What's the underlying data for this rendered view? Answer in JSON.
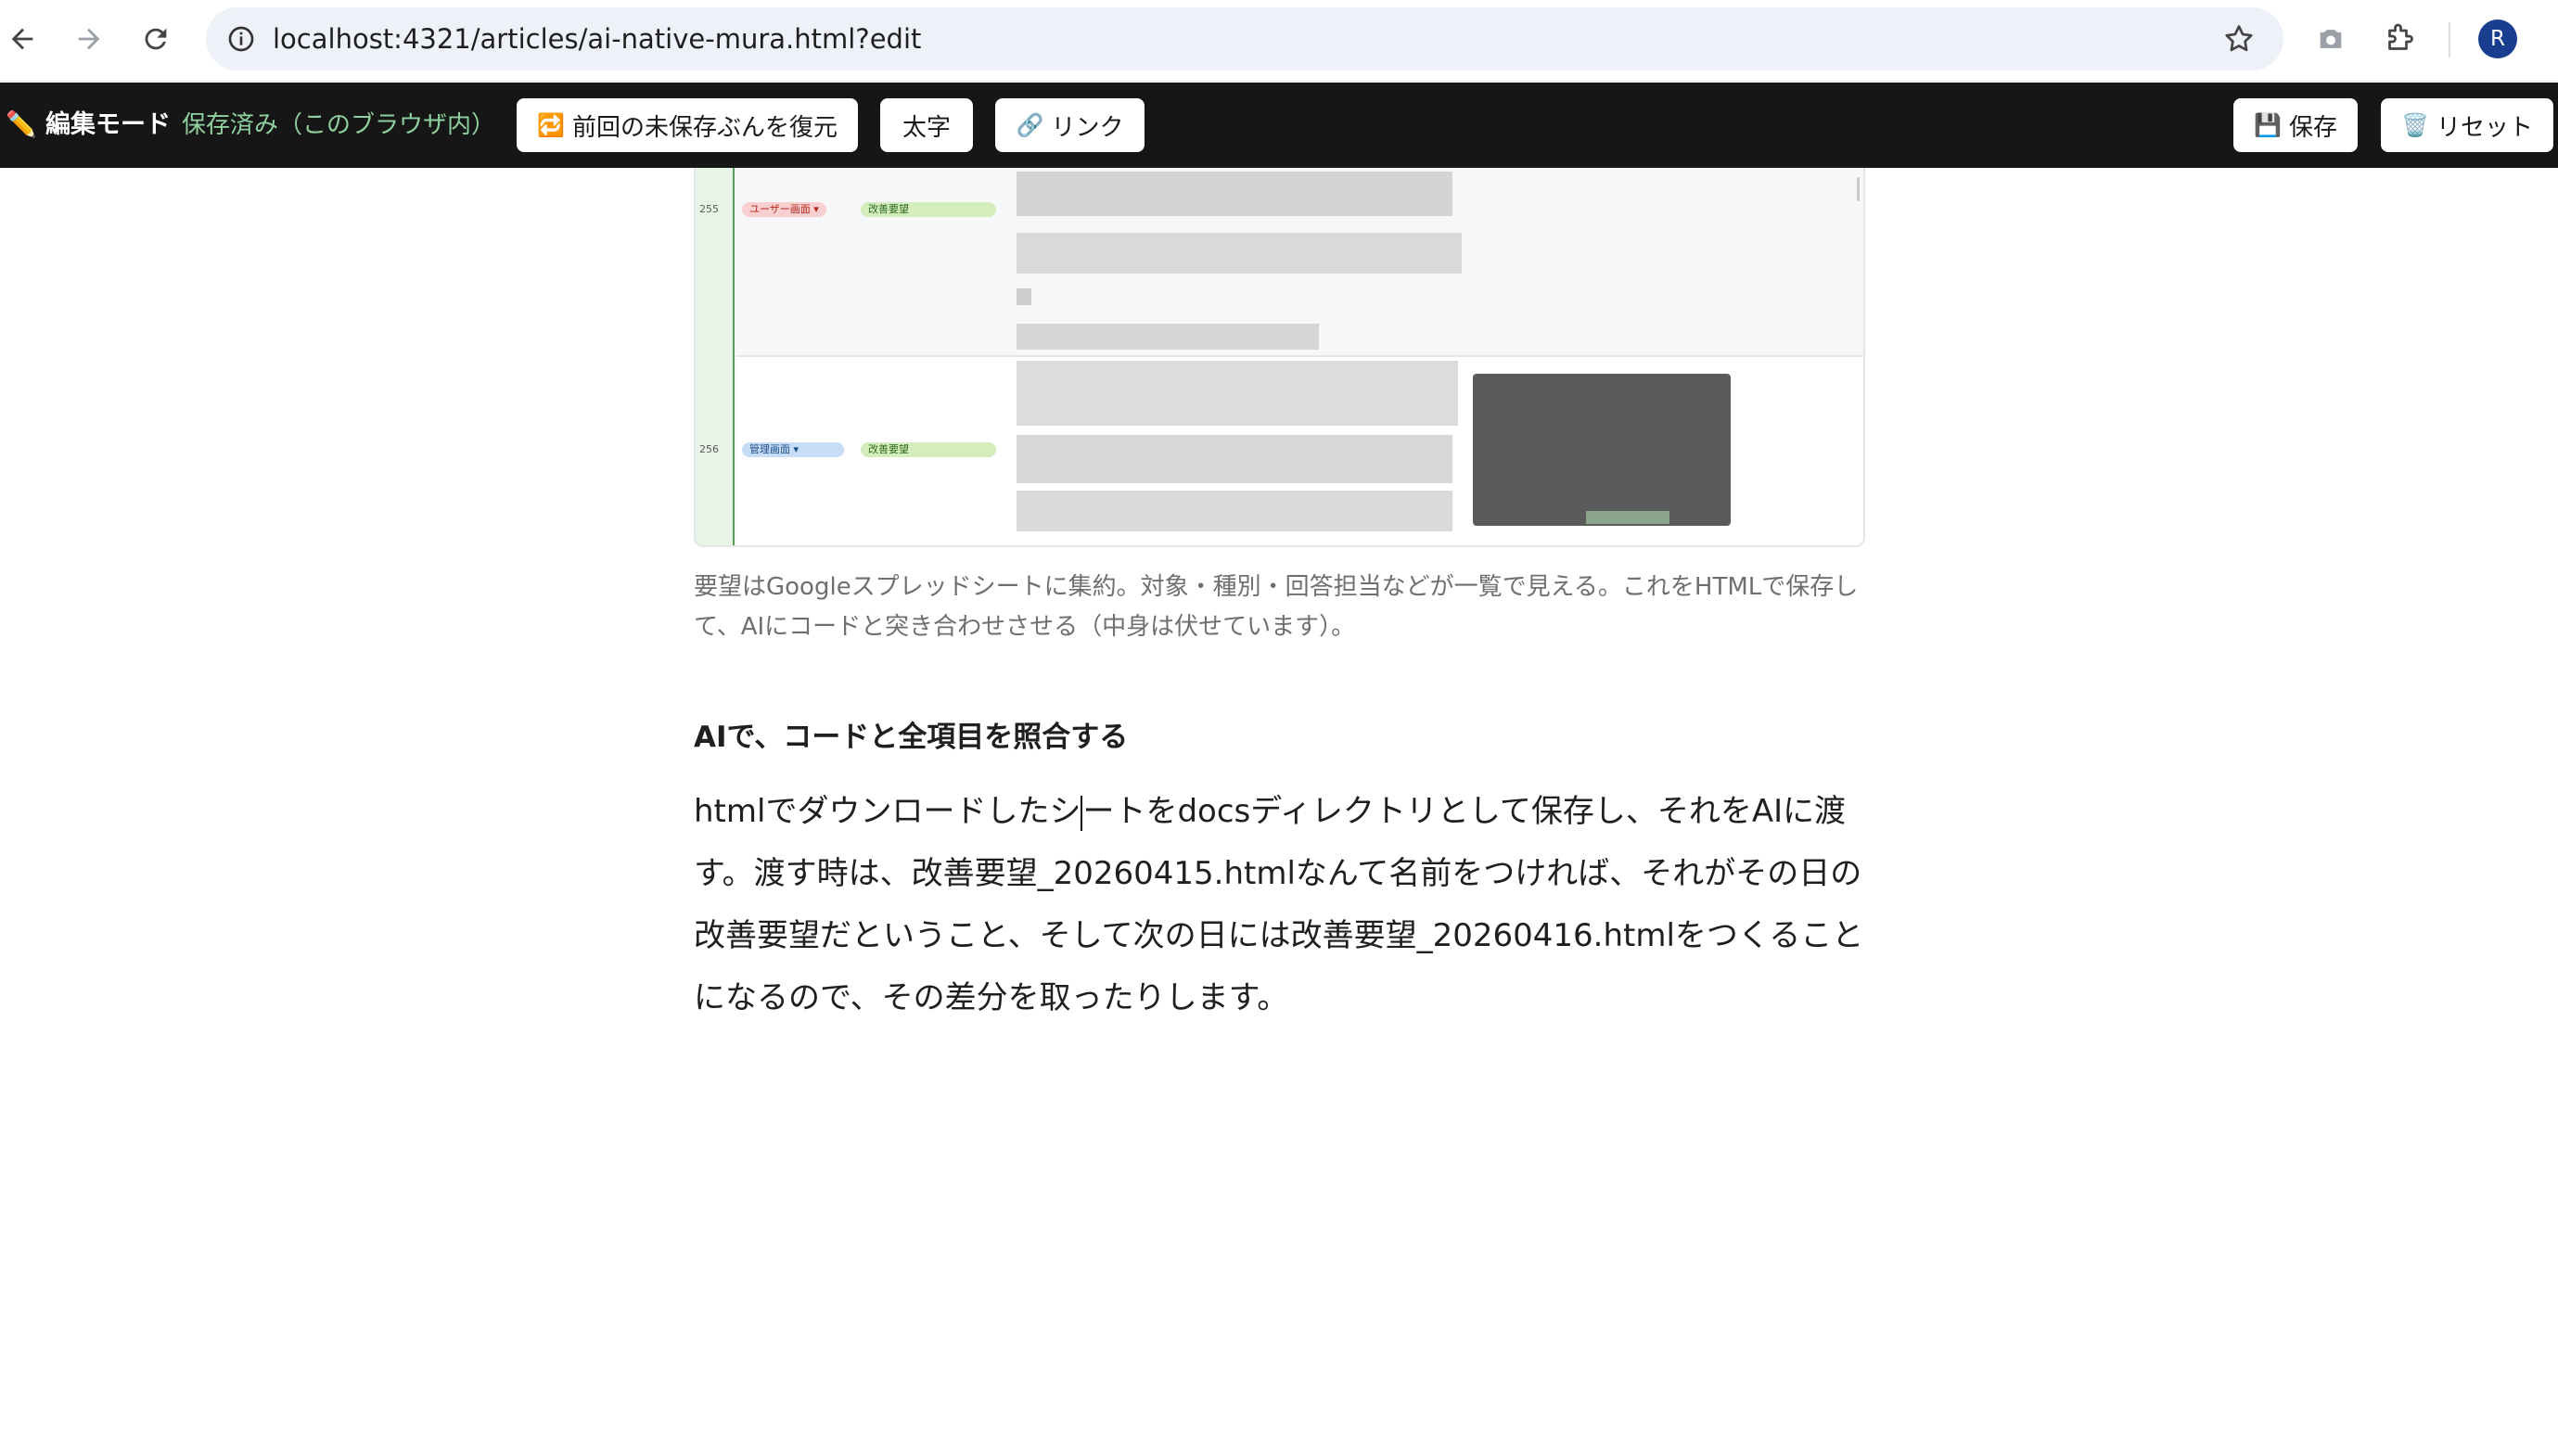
{
  "browser": {
    "url": "localhost:4321/articles/ai-native-mura.html?edit",
    "avatar_letter": "R",
    "icons": [
      "back-arrow-icon",
      "forward-arrow-icon",
      "reload-icon",
      "info-icon",
      "star-icon",
      "camera-icon",
      "extensions-puzzle-icon"
    ]
  },
  "edit_toolbar": {
    "mode_label": "✏️ 編集モード",
    "status": "保存済み（このブラウザ内）",
    "restore_button": "前回の未保存ぶんを復元",
    "bold_button": "太字",
    "link_button": "リンク",
    "save_button": "保存",
    "reset_button": "リセット",
    "colors": {
      "bar_bg": "#161616",
      "status_text": "#8fd19e"
    }
  },
  "figure": {
    "rows": [
      {
        "number": "255",
        "category": "ユーザー画面",
        "type": "改善要望"
      },
      {
        "number": "256",
        "category": "管理画面",
        "type": "改善要望"
      }
    ]
  },
  "article": {
    "caption": "要望はGoogleスプレッドシートに集約。対象・種別・回答担当などが一覧で見える。これをHTMLで保存して、AIにコードと突き合わせさせる（中身は伏せています）。",
    "heading": "AIで、コードと全項目を照合する",
    "paragraph_before_caret": "htmlでダウンロードしたシ",
    "paragraph_after_caret": "ートをdocsディレクトリとして保存し、それをAIに渡す。渡す時は、改善要望_20260415.htmlなんて名前をつければ、それがその日の改善要望だということ、そして次の日には改善要望_20260416.htmlをつくることになるので、その差分を取ったりします。"
  }
}
